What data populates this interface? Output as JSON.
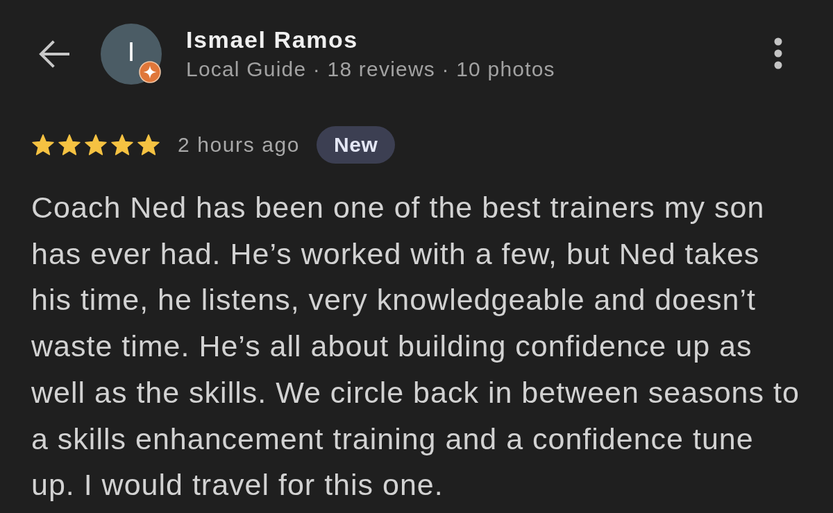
{
  "reviewer": {
    "initial": "I",
    "name": "Ismael Ramos",
    "details": "Local Guide · 18 reviews · 10 photos"
  },
  "review": {
    "stars": 5,
    "time": "2 hours ago",
    "badge": "New",
    "text": "Coach Ned has been one of the best trainers my son has ever had. He’s worked with a few, but Ned takes his time, he listens, very knowledgeable and doesn’t waste time. He’s all about building confidence up as well as the skills. We circle back in between seasons to a skills enhancement training and a confidence tune up. I would travel for this one."
  }
}
